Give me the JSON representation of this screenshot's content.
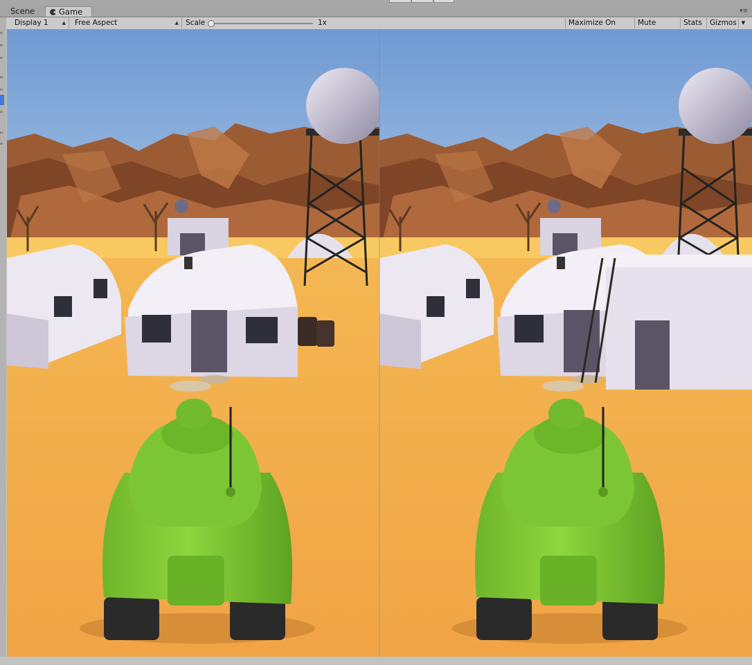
{
  "tabs": [
    {
      "label": "Scene",
      "active": false
    },
    {
      "label": "Game",
      "active": true,
      "icon": "pacman-icon"
    }
  ],
  "toolbar": {
    "display": "Display 1",
    "aspect": "Free Aspect",
    "scale_label": "Scale",
    "scale_value": "1x",
    "scale_level": 0.0,
    "maximize": "Maximize On Play",
    "mute": "Mute Audio",
    "stats": "Stats",
    "gizmos": "Gizmos"
  },
  "viewport": {
    "description_icon": "stereo-game-view",
    "colors": {
      "sky": "#7ea7d8",
      "ground": "#f4a84a",
      "rock": "#9a5a33",
      "tank": "#7fc633",
      "building": "#e9e5ef"
    }
  }
}
